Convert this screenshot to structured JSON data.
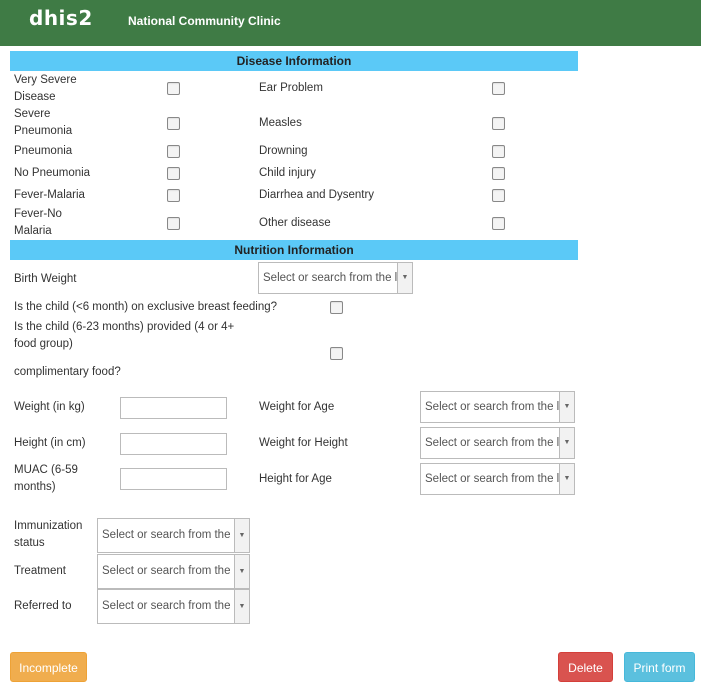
{
  "header": {
    "logo": "dhis2",
    "app_name": "National Community Clinic"
  },
  "disease_section": {
    "title": "Disease Information",
    "rows": [
      {
        "left": "Very Severe Disease",
        "right": "Ear Problem"
      },
      {
        "left": "Severe Pneumonia",
        "right": "Measles"
      },
      {
        "left": "Pneumonia",
        "right": "Drowning"
      },
      {
        "left": "No Pneumonia",
        "right": "Child injury"
      },
      {
        "left": "Fever-Malaria",
        "right": "Diarrhea and Dysentry"
      },
      {
        "left": "Fever-No Malaria",
        "right": "Other disease"
      }
    ]
  },
  "nutrition_section": {
    "title": "Nutrition Information",
    "birth_weight": {
      "label": "Birth Weight",
      "value": "Select or search from the list"
    },
    "q_breastfeeding": "Is the child (<6 month) on exclusive breast feeding?",
    "q_food_group": "Is the child (6-23 months) provided (4 or 4+ food group)",
    "q_food_group_cont": "complimentary food?",
    "weight_label": "Weight (in kg)",
    "height_label": "Height (in cm)",
    "muac_label": "MUAC (6-59 months)",
    "weight_for_age": {
      "label": "Weight for Age",
      "value": "Select or search from the list"
    },
    "weight_for_height": {
      "label": "Weight for Height",
      "value": "Select or search from the list"
    },
    "height_for_age": {
      "label": "Height for Age",
      "value": "Select or search from the list"
    }
  },
  "other": {
    "immunization": {
      "label": "Immunization status",
      "value": "Select or search from the list"
    },
    "treatment": {
      "label": "Treatment",
      "value": "Select or search from the list"
    },
    "referred": {
      "label": "Referred to",
      "value": "Select or search from the list"
    }
  },
  "buttons": {
    "incomplete": "Incomplete",
    "delete": "Delete",
    "print": "Print form"
  }
}
